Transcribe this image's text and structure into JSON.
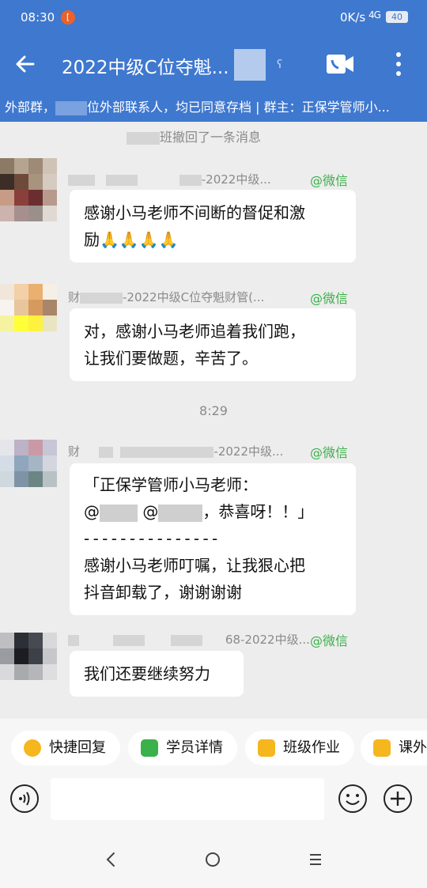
{
  "status_bar": {
    "time": "08:30",
    "notification_badge": "[",
    "net_speed": "0K/s",
    "signal": "4G",
    "battery": "40"
  },
  "header": {
    "title": "2022中级C位夺魁...",
    "icons": [
      "back-arrow-icon",
      "video-call-icon",
      "more-icon"
    ]
  },
  "banner": {
    "text_before": "外部群，",
    "text_after": "位外部联系人，均已同意存档 | 群主：正保学管师小..."
  },
  "chat": {
    "recall_text": "班撤回了一条消息",
    "messages": [
      {
        "sender_suffix": "-2022中级...",
        "tag": "@微信",
        "lines": [
          "感谢小马老师不间断的督促和激",
          "励🙏🙏🙏🙏"
        ]
      },
      {
        "sender_prefix": "财",
        "sender_suffix": "-2022中级C位夺魁财管(...",
        "tag": "@微信",
        "lines": [
          "对，感谢小马老师追着我们跑，",
          "让我们要做题，辛苦了。"
        ]
      }
    ],
    "timestamp": "8:29",
    "messages2": [
      {
        "sender_prefix": "财",
        "sender_suffix": "-2022中级...",
        "tag": "@微信",
        "line1": "「正保学管师小马老师：",
        "line2_a": "@",
        "line2_b": "@",
        "line2_c": "，恭喜呀！！」",
        "separator": "- - - - - - - - - - - - - - -",
        "line3": "感谢小马老师叮嘱，让我狠心把",
        "line4": "抖音卸载了，谢谢谢谢"
      },
      {
        "sender_suffix": "68-2022中级...",
        "tag": "@微信",
        "lines": [
          "我们还要继续努力"
        ]
      }
    ]
  },
  "quick_actions": [
    {
      "label": "快捷回复",
      "icon": "quick-reply-icon",
      "color": "#f5b61e"
    },
    {
      "label": "学员详情",
      "icon": "student-detail-icon",
      "color": "#3bb14a"
    },
    {
      "label": "班级作业",
      "icon": "homework-icon",
      "color": "#f5b61e"
    },
    {
      "label": "课外练",
      "icon": "extra-practice-icon",
      "color": "#f5b61e"
    }
  ],
  "input": {
    "placeholder": ""
  },
  "nav": {
    "icons": [
      "back-icon",
      "home-icon",
      "menu-icon"
    ]
  },
  "colors": {
    "header_blue": "#3f78cf",
    "wechat_green": "#3bb14a"
  }
}
